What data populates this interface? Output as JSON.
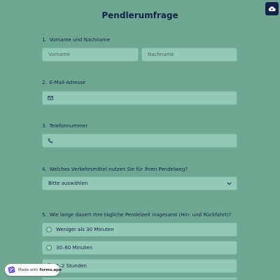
{
  "colors": {
    "background": "#6ea892",
    "field_background": "#94c8b6",
    "text_dark": "#14224a",
    "accent_logo": "#6c5ce7"
  },
  "header": {
    "title": "Pendlerumfrage",
    "cloud_icon": "cloud-upload-icon"
  },
  "questions": {
    "q1": {
      "number": "1.",
      "label": "Vorname und Nachname",
      "first_placeholder": "Vorname",
      "last_placeholder": "Nachname"
    },
    "q2": {
      "number": "2.",
      "label": "E-Mail-Adresse",
      "icon": "mail-icon"
    },
    "q3": {
      "number": "3.",
      "label": "Telefonnummer",
      "icon": "phone-icon"
    },
    "q4": {
      "number": "4.",
      "label": "Welches Verkehrsmittel nutzen Sie für Ihren Pendelweg?",
      "selected": "Bitte auswählen",
      "icon": "chevron-down-icon"
    },
    "q5": {
      "number": "5.",
      "label": "Wie lange dauert Ihre tägliche Pendelzeit insgesamt (Hin- und Rückfahrt)?",
      "options": [
        "Weniger als 30 Minuten",
        "30–60 Minuten",
        "1–2 Stunden"
      ]
    }
  },
  "badge": {
    "prefix": "Made with",
    "brand": "forms.app"
  }
}
